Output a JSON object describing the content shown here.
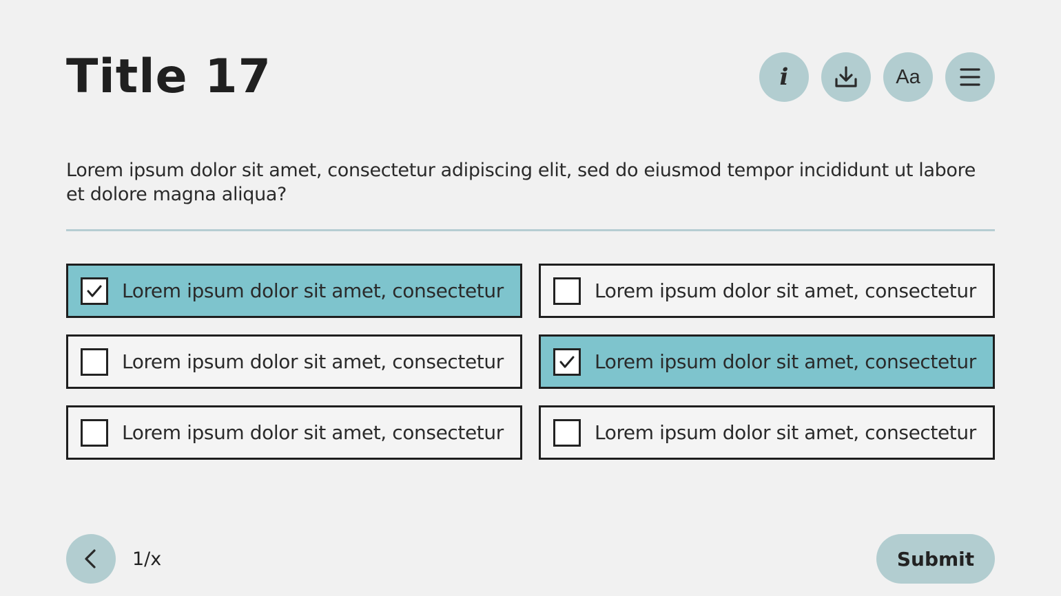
{
  "header": {
    "title": "Title 17",
    "toolbar": [
      {
        "name": "info-button",
        "icon": "info-icon"
      },
      {
        "name": "download-button",
        "icon": "download-icon"
      },
      {
        "name": "font-size-button",
        "icon": "text-size-icon",
        "glyph": "Aa"
      },
      {
        "name": "menu-button",
        "icon": "hamburger-menu-icon"
      }
    ]
  },
  "question": {
    "text": "Lorem ipsum dolor sit amet, consectetur adipiscing elit, sed do eiusmod tempor incididunt ut labore et dolore magna aliqua?"
  },
  "options": [
    {
      "label": "Lorem ipsum dolor sit amet, consectetur",
      "checked": true
    },
    {
      "label": "Lorem ipsum dolor sit amet, consectetur",
      "checked": false
    },
    {
      "label": "Lorem ipsum dolor sit amet, consectetur",
      "checked": false
    },
    {
      "label": "Lorem ipsum dolor sit amet, consectetur",
      "checked": true
    },
    {
      "label": "Lorem ipsum dolor sit amet, consectetur",
      "checked": false
    },
    {
      "label": "Lorem ipsum dolor sit amet, consectetur",
      "checked": false
    }
  ],
  "footer": {
    "back_icon": "chevron-left-icon",
    "page_count": "1/x",
    "submit_label": "Submit"
  },
  "colors": {
    "background": "#f1f1f1",
    "button": "#b2cdd0",
    "selected_option": "#7ec4cd",
    "divider": "#b6cdd2"
  }
}
